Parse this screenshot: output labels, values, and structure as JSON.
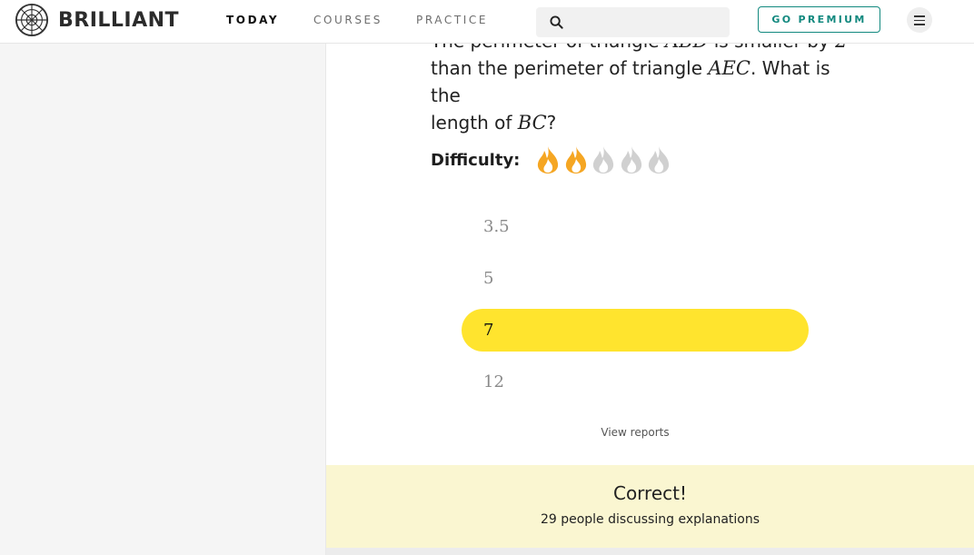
{
  "brand": {
    "name": "BRILLIANT"
  },
  "nav": {
    "items": [
      {
        "label": "TODAY",
        "active": true
      },
      {
        "label": "COURSES",
        "active": false
      },
      {
        "label": "PRACTICE",
        "active": false
      }
    ],
    "search_placeholder": "",
    "premium_label": "GO PREMIUM"
  },
  "question": {
    "line1_pre": "The perimeter of triangle ",
    "line1_math": "ABD",
    "line1_post": " is smaller by ",
    "line1_num": "2",
    "line2_pre": "than the perimeter of triangle ",
    "line2_math": "AEC",
    "line2_post": ". What is the",
    "line3_pre": "length of ",
    "line3_math": "BC",
    "line3_post": "?"
  },
  "difficulty": {
    "label": "Difficulty:",
    "level": 2,
    "max": 5
  },
  "options": [
    {
      "label": "3.5",
      "selected": false
    },
    {
      "label": "5",
      "selected": false
    },
    {
      "label": "7",
      "selected": true
    },
    {
      "label": "12",
      "selected": false
    }
  ],
  "view_reports": "View reports",
  "result": {
    "title": "Correct!",
    "subtitle": "29 people discussing explanations"
  },
  "colors": {
    "accent_teal": "#12897f",
    "selected_yellow": "#ffe42e",
    "result_bg": "#faf6d1",
    "flame_active": "#f5a623",
    "flame_inactive": "#d0d0d0"
  },
  "icons": {
    "logo": "brilliant-logo-icon",
    "search": "search-icon",
    "menu": "hamburger-menu-icon",
    "difficulty": "flame-icon"
  }
}
